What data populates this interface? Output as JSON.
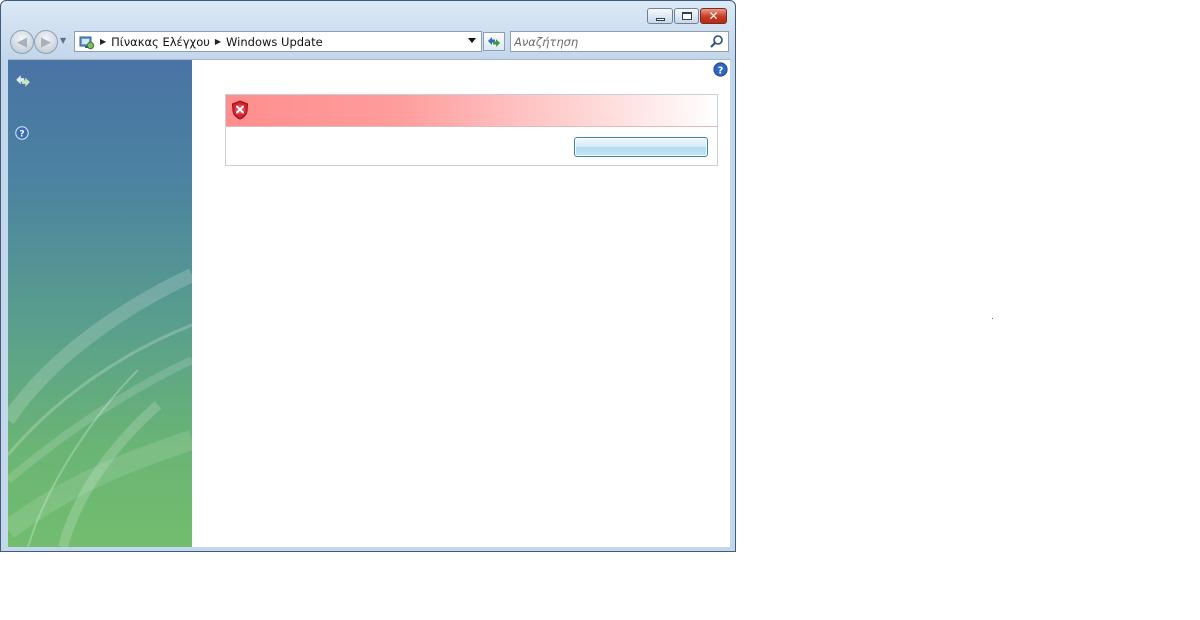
{
  "window": {
    "breadcrumbs": [
      "Πίνακας Ελέγχου",
      "Windows Update"
    ],
    "search": {
      "placeholder": "Αναζήτηση"
    }
  },
  "icons": {
    "back": "back-arrow-icon",
    "forward": "forward-arrow-icon",
    "address": "control-panel-icon",
    "refresh": "refresh-icon",
    "search": "magnifier-icon",
    "help": "help-icon",
    "sidebar_update": "windows-update-icon",
    "sidebar_help": "help-icon",
    "error": "error-shield-icon"
  },
  "colors": {
    "sidebar_top": "#4a73a5",
    "sidebar_bottom": "#72bd6f",
    "error_banner": "#ff8e8e",
    "close_button": "#c73b22"
  }
}
